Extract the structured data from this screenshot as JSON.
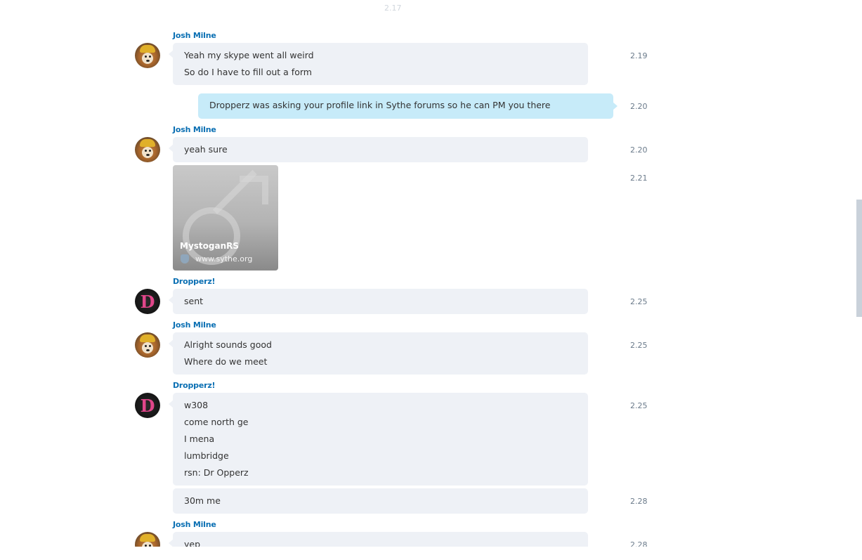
{
  "top_faded_time": "2.17",
  "messages": [
    {
      "sender": "Josh Milne",
      "lines": [
        "Yeah my skype went all weird",
        "So do I have to fill out a form"
      ],
      "time": "2.19"
    },
    {
      "own_text": "Dropperz was asking your profile link in Sythe forums so he can PM you there",
      "time": "2.20"
    },
    {
      "sender": "Josh Milne",
      "lines": [
        "yeah sure"
      ],
      "time": "2.20"
    },
    {
      "card_title": "MystoganRS",
      "card_site": "www.sythe.org",
      "time": "2.21"
    },
    {
      "sender": "Dropperz!",
      "lines": [
        "sent"
      ],
      "time": "2.25"
    },
    {
      "sender": "Josh Milne",
      "lines": [
        "Alright sounds good",
        "Where do we meet"
      ],
      "time": "2.25"
    },
    {
      "sender": "Dropperz!",
      "lines": [
        "w308",
        "come north ge",
        "I mena",
        "lumbridge",
        "rsn: Dr Opperz"
      ],
      "time": "2.25"
    },
    {
      "lines": [
        "30m me"
      ],
      "time": "2.28"
    },
    {
      "sender": "Josh Milne",
      "lines": [
        "yep"
      ],
      "time": "2.28"
    }
  ],
  "avatar_icons": {
    "josh": "dog-avatar",
    "dropperz": "letter-d-avatar"
  },
  "colors": {
    "sender": "#0a6fb3",
    "bubble": "#eef1f6",
    "own_bubble": "#c7ebf9",
    "time": "#6a7a8a"
  }
}
